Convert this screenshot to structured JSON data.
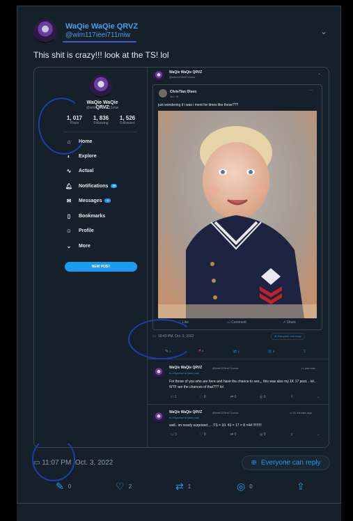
{
  "tweet": {
    "name": "WaQie WaQie QRVZ",
    "handle": "@wim117ieei711miw",
    "text": "This shit is crazy!!! look at the TS! lol",
    "timestamp": "11:07 PM",
    "date": "Oct. 3, 2022",
    "reply_setting": "Everyone can reply",
    "actions": {
      "reply_count": "0",
      "like_count": "2",
      "repost_count": "1",
      "views_count": "0"
    }
  },
  "screenshot": {
    "sidebar": {
      "name": "WaQie WaQie QRVZ",
      "handle": "@wim117ieei711miw",
      "stats": [
        {
          "value": "1, 017",
          "label": "Posts"
        },
        {
          "value": "1, 836",
          "label": "Following"
        },
        {
          "value": "1, 526",
          "label": "Followers"
        }
      ],
      "nav": [
        {
          "label": "Home",
          "icon": "home-icon",
          "glyph": "⌂"
        },
        {
          "label": "Explore",
          "icon": "explore-icon",
          "glyph": "◐"
        },
        {
          "label": "Actual",
          "icon": "pulse-icon",
          "glyph": "∿"
        },
        {
          "label": "Notifications",
          "icon": "bell-icon",
          "glyph": "🔔︎",
          "badge": "20"
        },
        {
          "label": "Messages",
          "icon": "mail-icon",
          "glyph": "✉",
          "badge": "1"
        },
        {
          "label": "Bookmarks",
          "icon": "bookmark-icon",
          "glyph": "▯"
        },
        {
          "label": "Profile",
          "icon": "profile-icon",
          "glyph": "☺"
        },
        {
          "label": "More",
          "icon": "chevron-down-icon",
          "glyph": "⌄"
        }
      ],
      "new_post": "NEW POST"
    },
    "main_post": {
      "name": "WaQie WaQie QRVZ",
      "handle": "@wim117ieei711miw"
    },
    "quoted": {
      "name": "ChrisTian Olsen",
      "time": "1m · ⊕",
      "text": "just wondering if i was i ment for times like these???",
      "actions": [
        "Like",
        "Comment",
        "Share"
      ]
    },
    "post_meta": {
      "time": "10:43 PM, Oct. 3, 2022",
      "reply_setting": "Everyone can reply",
      "counts": [
        "1",
        "4",
        "1",
        "0"
      ]
    },
    "replies": [
      {
        "name": "WaQie WaQie QRVZ",
        "handle": "@wim117ieei711miw",
        "time": "just now",
        "context": "In response to your post",
        "text": "For those of you who are here and have the chance to see,,, this was also my 1K 17 post... lol... WTF are the chances of that??? lol",
        "counts": [
          "1",
          "0",
          "0",
          "0"
        ]
      },
      {
        "name": "WaQie WaQie QRVZ",
        "handle": "@wim117ieei711miw",
        "time": "11 minutes ago",
        "context": "In response to your post",
        "text": "well.. im nearly surprised..... TS = 10. 43 = 17 = 8 =44 !!!!!!!!!",
        "counts": [
          "3",
          "0",
          "0",
          "0"
        ]
      }
    ]
  },
  "colors": {
    "background": "#16202a",
    "accent": "#1d9bf0",
    "name_link": "#4a9ee8",
    "like": "#f91880",
    "scribble": "#1f3fb8"
  }
}
